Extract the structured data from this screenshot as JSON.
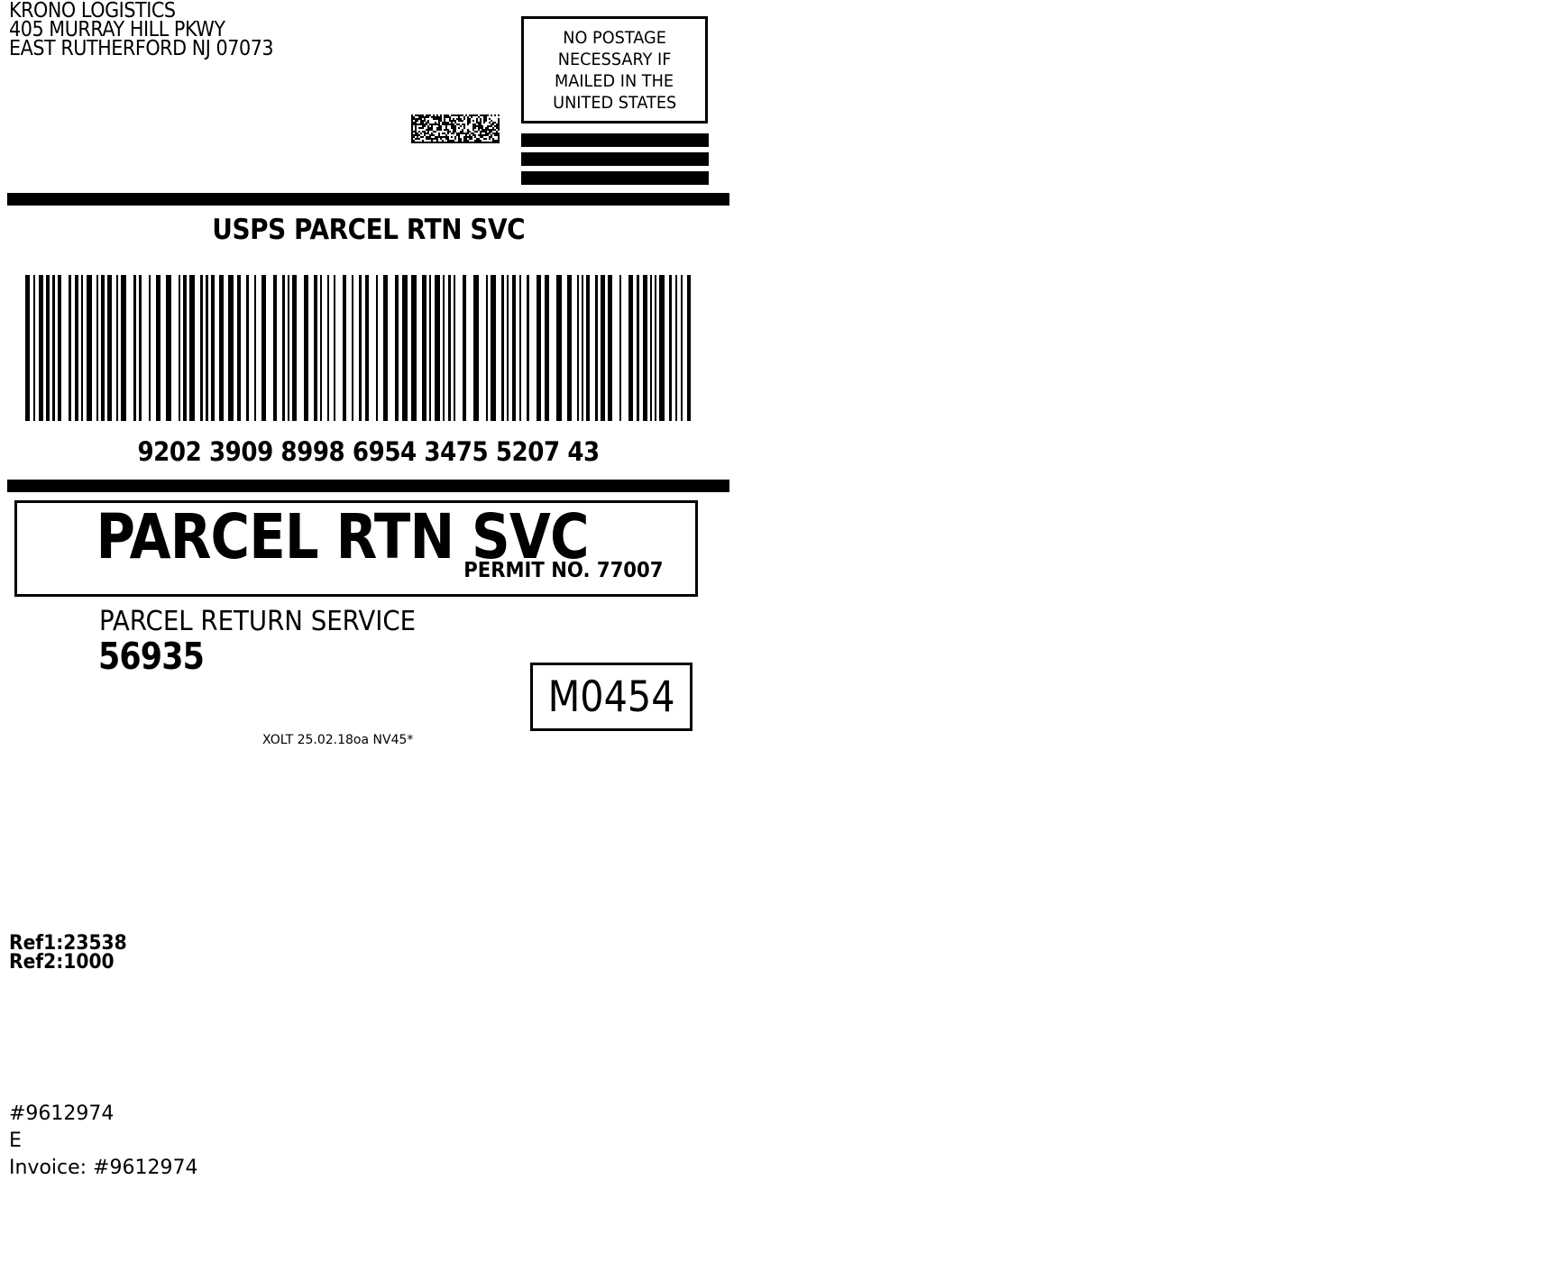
{
  "sender": {
    "name": "KRONO LOGISTICS",
    "street": "405 MURRAY HILL PKWY",
    "city_line": "EAST RUTHERFORD  NJ  07073"
  },
  "postage": {
    "lines": [
      "NO POSTAGE",
      "NECESSARY IF",
      "MAILED IN THE",
      "UNITED STATES"
    ]
  },
  "service": {
    "title": "USPS PARCEL RTN SVC",
    "tracking_number": "9202 3909 8998 6954 3475 5207 43"
  },
  "permit": {
    "main": "PARCEL RTN SVC",
    "number": "PERMIT NO. 77007"
  },
  "return_service": {
    "label": "PARCEL RETURN SERVICE",
    "code": "56935",
    "route": "M0454"
  },
  "software_version": "XOLT 25.02.18oa NV45*",
  "references": {
    "ref1": "Ref1:23538",
    "ref2": "Ref2:1000"
  },
  "notes": {
    "line1": "#9612974",
    "line2": "E",
    "line3": "Invoice: #9612974"
  }
}
